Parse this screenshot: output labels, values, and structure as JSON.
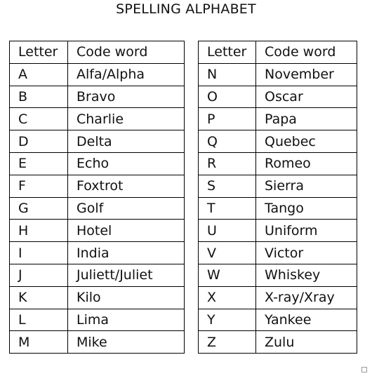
{
  "title": "SPELLING ALPHABET",
  "tables": [
    {
      "headers": [
        "Letter",
        "Code word"
      ],
      "rows": [
        [
          "A",
          "Alfa/Alpha"
        ],
        [
          "B",
          "Bravo"
        ],
        [
          "C",
          "Charlie"
        ],
        [
          "D",
          "Delta"
        ],
        [
          "E",
          "Echo"
        ],
        [
          "F",
          "Foxtrot"
        ],
        [
          "G",
          "Golf"
        ],
        [
          "H",
          "Hotel"
        ],
        [
          "I",
          "India"
        ],
        [
          "J",
          "Juliett/Juliet"
        ],
        [
          "K",
          "Kilo"
        ],
        [
          "L",
          "Lima"
        ],
        [
          "M",
          "Mike"
        ]
      ]
    },
    {
      "headers": [
        "Letter",
        "Code word"
      ],
      "rows": [
        [
          "N",
          "November"
        ],
        [
          "O",
          "Oscar"
        ],
        [
          "P",
          "Papa"
        ],
        [
          "Q",
          "Quebec"
        ],
        [
          "R",
          "Romeo"
        ],
        [
          "S",
          "Sierra"
        ],
        [
          "T",
          "Tango"
        ],
        [
          "U",
          "Uniform"
        ],
        [
          "V",
          "Victor"
        ],
        [
          "W",
          "Whiskey"
        ],
        [
          "X",
          "X-ray/Xray"
        ],
        [
          "Y",
          "Yankee"
        ],
        [
          "Z",
          "Zulu"
        ]
      ]
    }
  ]
}
